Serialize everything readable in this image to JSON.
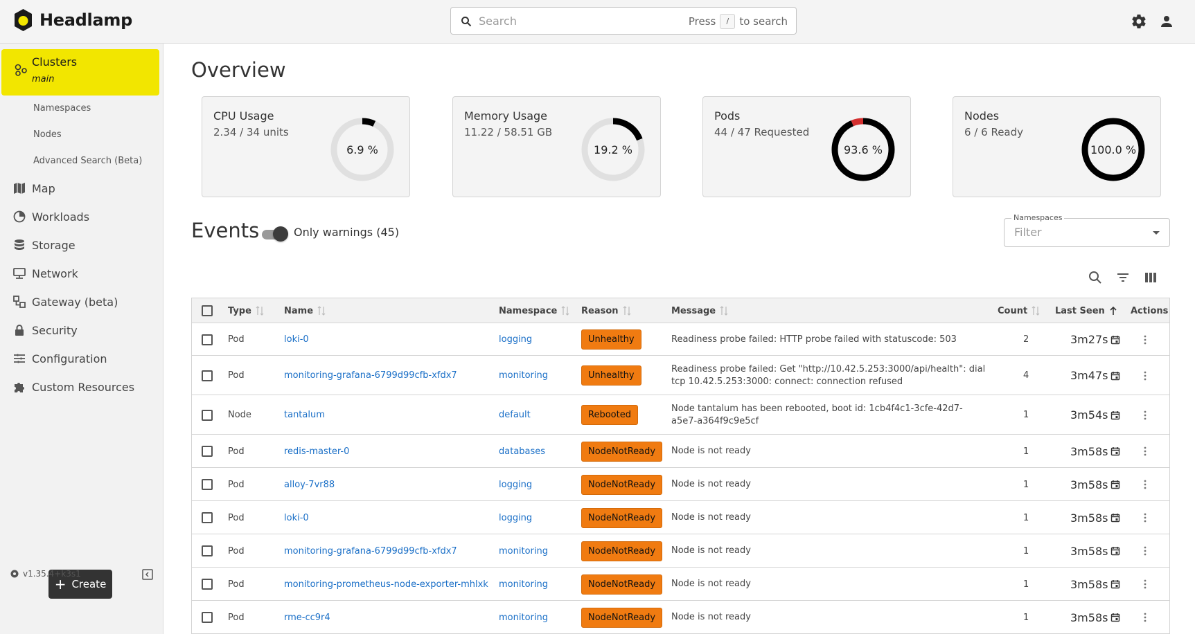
{
  "app": {
    "name": "Headlamp",
    "search_placeholder": "Search",
    "search_hint_press": "Press",
    "search_hint_key": "/",
    "search_hint_to": "to search"
  },
  "sidebar": {
    "cluster_label": "Clusters",
    "cluster_name": "main",
    "sub_items": [
      "Namespaces",
      "Nodes",
      "Advanced Search (Beta)"
    ],
    "items": [
      {
        "label": "Map",
        "icon": "map-icon"
      },
      {
        "label": "Workloads",
        "icon": "workloads-icon"
      },
      {
        "label": "Storage",
        "icon": "storage-icon"
      },
      {
        "label": "Network",
        "icon": "network-icon"
      },
      {
        "label": "Gateway (beta)",
        "icon": "gateway-icon"
      },
      {
        "label": "Security",
        "icon": "lock-icon"
      },
      {
        "label": "Configuration",
        "icon": "configuration-icon"
      },
      {
        "label": "Custom Resources",
        "icon": "puzzle-icon"
      }
    ],
    "create_label": "Create",
    "version": "v1.35.4+k3s1"
  },
  "overview": {
    "title": "Overview",
    "cards": [
      {
        "title": "CPU Usage",
        "value": "2.34 / 34 units",
        "percent_label": "6.9 %",
        "percent": 6.9
      },
      {
        "title": "Memory Usage",
        "value": "11.22 / 58.51 GB",
        "percent_label": "19.2 %",
        "percent": 19.2
      },
      {
        "title": "Pods",
        "value": "44 / 47 Requested",
        "percent_label": "93.6 %",
        "percent": 93.6
      },
      {
        "title": "Nodes",
        "value": "6 / 6 Ready",
        "percent_label": "100.0 %",
        "percent": 100.0
      }
    ]
  },
  "events": {
    "title": "Events",
    "toggle_label": "Only warnings (45)",
    "namespaces_label": "Namespaces",
    "namespaces_placeholder": "Filter",
    "columns": {
      "type": "Type",
      "name": "Name",
      "namespace": "Namespace",
      "reason": "Reason",
      "message": "Message",
      "count": "Count",
      "last_seen": "Last Seen",
      "actions": "Actions"
    },
    "rows": [
      {
        "type": "Pod",
        "name": "loki-0",
        "namespace": "logging",
        "reason": "Unhealthy",
        "message": "Readiness probe failed: HTTP probe failed with statuscode: 503",
        "count": "2",
        "last_seen": "3m27s"
      },
      {
        "type": "Pod",
        "name": "monitoring-grafana-6799d99cfb-xfdx7",
        "namespace": "monitoring",
        "reason": "Unhealthy",
        "message": "Readiness probe failed: Get \"http://10.42.5.253:3000/api/health\": dial tcp 10.42.5.253:3000: connect: connection refused",
        "count": "4",
        "last_seen": "3m47s"
      },
      {
        "type": "Node",
        "name": "tantalum",
        "namespace": "default",
        "reason": "Rebooted",
        "message": "Node tantalum has been rebooted, boot id: 1cb4f4c1-3cfe-42d7-a5e7-a364f9c9e5cf",
        "count": "1",
        "last_seen": "3m54s"
      },
      {
        "type": "Pod",
        "name": "redis-master-0",
        "namespace": "databases",
        "reason": "NodeNotReady",
        "message": "Node is not ready",
        "count": "1",
        "last_seen": "3m58s"
      },
      {
        "type": "Pod",
        "name": "alloy-7vr88",
        "namespace": "logging",
        "reason": "NodeNotReady",
        "message": "Node is not ready",
        "count": "1",
        "last_seen": "3m58s"
      },
      {
        "type": "Pod",
        "name": "loki-0",
        "namespace": "logging",
        "reason": "NodeNotReady",
        "message": "Node is not ready",
        "count": "1",
        "last_seen": "3m58s"
      },
      {
        "type": "Pod",
        "name": "monitoring-grafana-6799d99cfb-xfdx7",
        "namespace": "monitoring",
        "reason": "NodeNotReady",
        "message": "Node is not ready",
        "count": "1",
        "last_seen": "3m58s"
      },
      {
        "type": "Pod",
        "name": "monitoring-prometheus-node-exporter-mhlxk",
        "namespace": "monitoring",
        "reason": "NodeNotReady",
        "message": "Node is not ready",
        "count": "1",
        "last_seen": "3m58s"
      },
      {
        "type": "Pod",
        "name": "rme-cc9r4",
        "namespace": "monitoring",
        "reason": "NodeNotReady",
        "message": "Node is not ready",
        "count": "1",
        "last_seen": "3m58s"
      }
    ]
  },
  "colors": {
    "accent_yellow": "#f2e600",
    "warning_orange": "#f07b11",
    "link_blue": "#1a6fc7",
    "donut_track": "#e0e0e0",
    "donut_fill": "#000000",
    "donut_warn": "#d32f2f"
  }
}
